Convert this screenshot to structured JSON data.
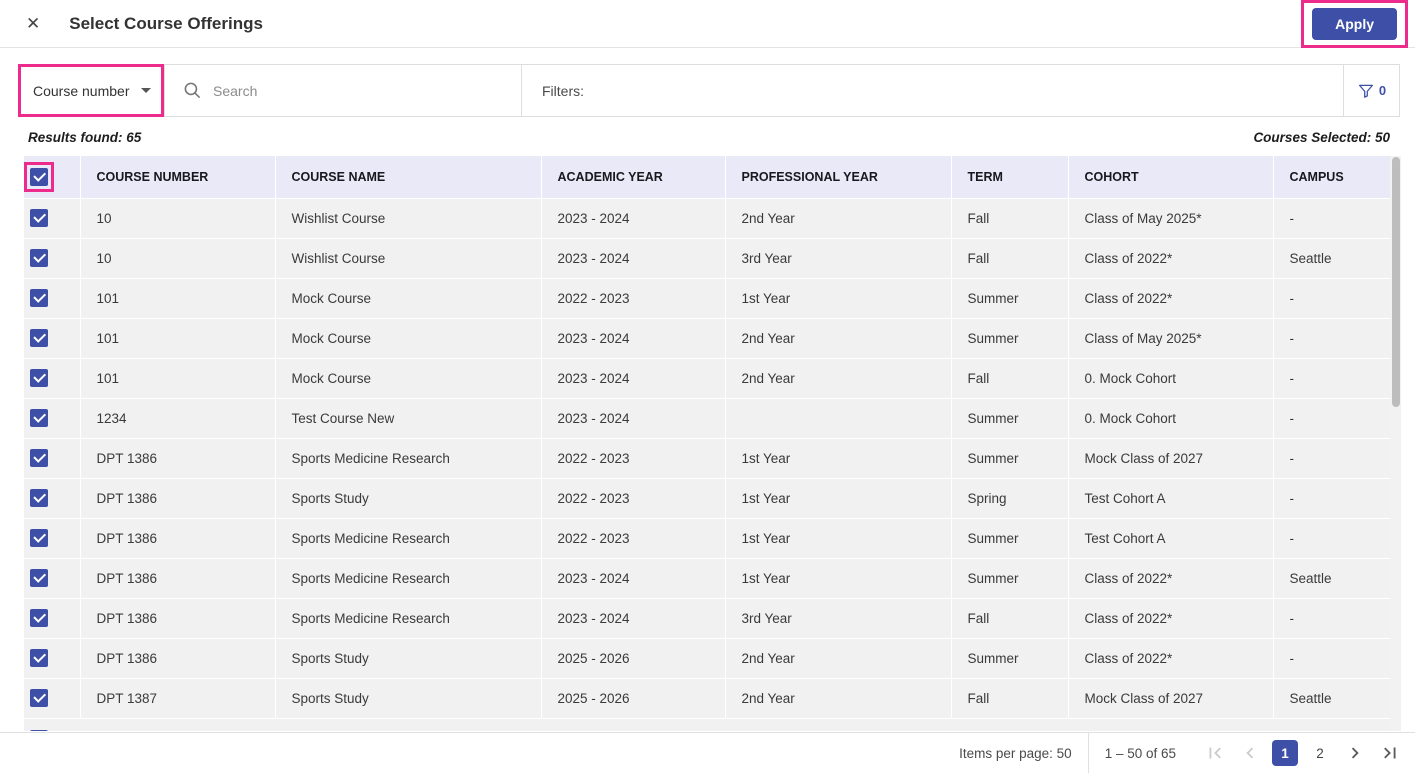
{
  "colors": {
    "accent": "#3e4fa8",
    "annotation": "#ec2b8d",
    "table_header_bg": "#e9e9f8",
    "row_bg": "#f1f1f1"
  },
  "header": {
    "title": "Select Course Offerings",
    "close_icon": "✕",
    "apply_button": "Apply"
  },
  "toolbar": {
    "search_by_dropdown": {
      "value": "Course number"
    },
    "search": {
      "placeholder": "Search"
    },
    "filters_label": "Filters:",
    "filter_count": "0"
  },
  "summary": {
    "results_found": "Results found: 65",
    "courses_selected": "Courses Selected: 50"
  },
  "table": {
    "select_all_checked": true,
    "columns": [
      "COURSE NUMBER",
      "COURSE NAME",
      "ACADEMIC YEAR",
      "PROFESSIONAL YEAR",
      "TERM",
      "COHORT",
      "CAMPUS"
    ],
    "rows": [
      {
        "checked": true,
        "course_number": "10",
        "course_name": "Wishlist Course",
        "academic_year": "2023 - 2024",
        "professional_year": "2nd Year",
        "term": "Fall",
        "cohort": "Class of May 2025*",
        "campus": "-"
      },
      {
        "checked": true,
        "course_number": "10",
        "course_name": "Wishlist Course",
        "academic_year": "2023 - 2024",
        "professional_year": "3rd Year",
        "term": "Fall",
        "cohort": "Class of 2022*",
        "campus": "Seattle"
      },
      {
        "checked": true,
        "course_number": "101",
        "course_name": "Mock Course",
        "academic_year": "2022 - 2023",
        "professional_year": "1st Year",
        "term": "Summer",
        "cohort": "Class of 2022*",
        "campus": "-"
      },
      {
        "checked": true,
        "course_number": "101",
        "course_name": "Mock Course",
        "academic_year": "2023 - 2024",
        "professional_year": "2nd Year",
        "term": "Summer",
        "cohort": "Class of May 2025*",
        "campus": "-"
      },
      {
        "checked": true,
        "course_number": "101",
        "course_name": "Mock Course",
        "academic_year": "2023 - 2024",
        "professional_year": "2nd Year",
        "term": "Fall",
        "cohort": "0. Mock Cohort",
        "campus": "-"
      },
      {
        "checked": true,
        "course_number": "1234",
        "course_name": "Test Course New",
        "academic_year": "2023 - 2024",
        "professional_year": "",
        "term": "Summer",
        "cohort": "0. Mock Cohort",
        "campus": "-"
      },
      {
        "checked": true,
        "course_number": "DPT 1386",
        "course_name": "Sports Medicine Research",
        "academic_year": "2022 - 2023",
        "professional_year": "1st Year",
        "term": "Summer",
        "cohort": "Mock Class of 2027",
        "campus": "-"
      },
      {
        "checked": true,
        "course_number": "DPT 1386",
        "course_name": "Sports Study",
        "academic_year": "2022 - 2023",
        "professional_year": "1st Year",
        "term": "Spring",
        "cohort": "Test Cohort A",
        "campus": "-"
      },
      {
        "checked": true,
        "course_number": "DPT 1386",
        "course_name": "Sports Medicine Research",
        "academic_year": "2022 - 2023",
        "professional_year": "1st Year",
        "term": "Summer",
        "cohort": "Test Cohort A",
        "campus": "-"
      },
      {
        "checked": true,
        "course_number": "DPT 1386",
        "course_name": "Sports Medicine Research",
        "academic_year": "2023 - 2024",
        "professional_year": "1st Year",
        "term": "Summer",
        "cohort": "Class of 2022*",
        "campus": "Seattle"
      },
      {
        "checked": true,
        "course_number": "DPT 1386",
        "course_name": "Sports Medicine Research",
        "academic_year": "2023 - 2024",
        "professional_year": "3rd Year",
        "term": "Fall",
        "cohort": "Class of 2022*",
        "campus": "-"
      },
      {
        "checked": true,
        "course_number": "DPT 1386",
        "course_name": "Sports Study",
        "academic_year": "2025 - 2026",
        "professional_year": "2nd Year",
        "term": "Summer",
        "cohort": "Class of 2022*",
        "campus": "-"
      },
      {
        "checked": true,
        "course_number": "DPT 1387",
        "course_name": "Sports Study",
        "academic_year": "2025 - 2026",
        "professional_year": "2nd Year",
        "term": "Fall",
        "cohort": "Mock Class of 2027",
        "campus": "Seattle"
      }
    ]
  },
  "footer": {
    "items_per_page": "Items per page: 50",
    "range": "1 – 50 of 65",
    "pages": [
      "1",
      "2"
    ],
    "active_page": "1"
  }
}
